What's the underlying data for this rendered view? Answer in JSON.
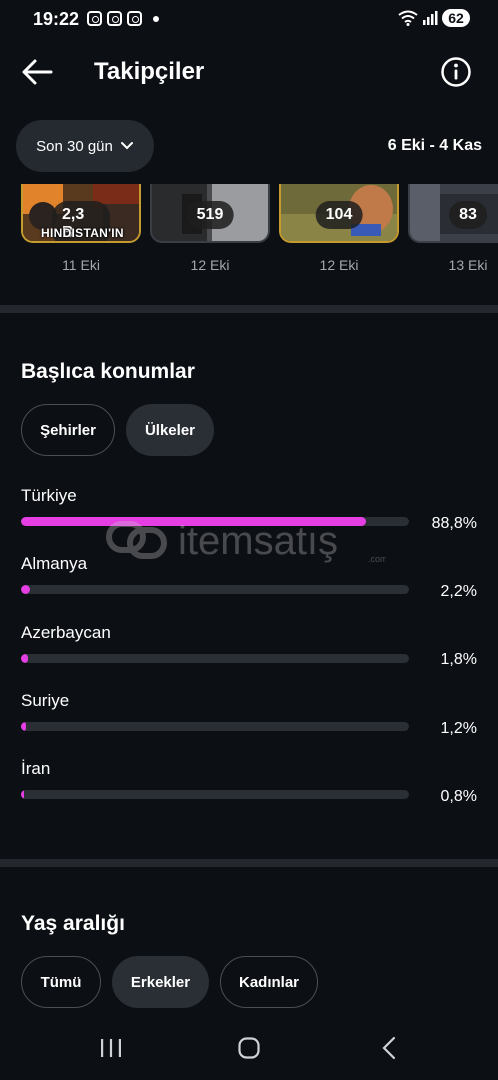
{
  "status": {
    "time": "19:22",
    "battery": "62"
  },
  "header": {
    "title": "Takipçiler"
  },
  "filters": {
    "period_label": "Son 30 gün",
    "date_range": "6 Eki - 4 Kas"
  },
  "thumbnails": [
    {
      "count": "2,3 B",
      "date": "11 Eki",
      "caption": "HINDISTAN'IN"
    },
    {
      "count": "519",
      "date": "12 Eki"
    },
    {
      "count": "104",
      "date": "12 Eki"
    },
    {
      "count": "83",
      "date": "13 Eki"
    }
  ],
  "locations": {
    "title": "Başlıca konumlar",
    "tabs": [
      "Şehirler",
      "Ülkeler"
    ],
    "selected_tab": "Ülkeler",
    "accent_color": "#e53fe4",
    "items": [
      {
        "name": "Türkiye",
        "percent": "88,8%",
        "value": 88.8
      },
      {
        "name": "Almanya",
        "percent": "2,2%",
        "value": 2.2
      },
      {
        "name": "Azerbaycan",
        "percent": "1,8%",
        "value": 1.8
      },
      {
        "name": "Suriye",
        "percent": "1,2%",
        "value": 1.2
      },
      {
        "name": "İran",
        "percent": "0,8%",
        "value": 0.8
      }
    ]
  },
  "age": {
    "title": "Yaş aralığı",
    "tabs": [
      "Tümü",
      "Erkekler",
      "Kadınlar"
    ],
    "selected_tab": "Erkekler"
  },
  "watermark": {
    "brand": "itemsatış",
    "domain": ".com"
  }
}
